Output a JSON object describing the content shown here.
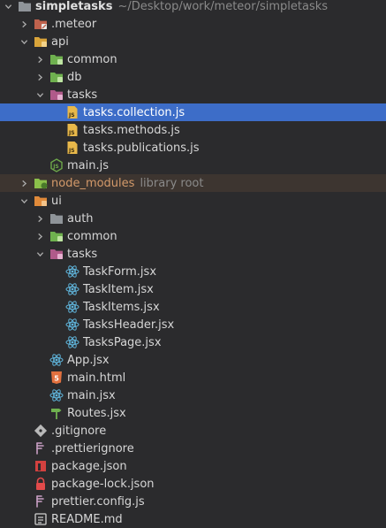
{
  "project": {
    "name": "simpletasks",
    "path": "~/Desktop/work/meteor/simpletasks"
  },
  "rows": [
    {
      "label": "simpletasks",
      "suffix": "~/Desktop/work/meteor/simpletasks",
      "icon": "folder-icon",
      "level": 0,
      "arrow": "down",
      "kind": "root"
    },
    {
      "label": ".meteor",
      "icon": "folder-icon",
      "level": 1,
      "arrow": "right"
    },
    {
      "label": "api",
      "icon": "folder-open-icon",
      "level": 1,
      "arrow": "down"
    },
    {
      "label": "common",
      "icon": "folder-icon",
      "level": 2,
      "arrow": "right"
    },
    {
      "label": "db",
      "icon": "folder-icon",
      "level": 2,
      "arrow": "right"
    },
    {
      "label": "tasks",
      "icon": "folder-icon",
      "level": 2,
      "arrow": "down"
    },
    {
      "label": "tasks.collection.js",
      "icon": "js-file-icon",
      "level": 3,
      "arrow": "none",
      "selected": true
    },
    {
      "label": "tasks.methods.js",
      "icon": "js-file-icon",
      "level": 3,
      "arrow": "none"
    },
    {
      "label": "tasks.publications.js",
      "icon": "js-file-icon",
      "level": 3,
      "arrow": "none"
    },
    {
      "label": "main.js",
      "icon": "nodejs-icon",
      "level": 2,
      "arrow": "none"
    },
    {
      "label": "node_modules",
      "suffix": "library root",
      "icon": "folder-icon",
      "level": 1,
      "arrow": "right",
      "kind": "excluded"
    },
    {
      "label": "ui",
      "icon": "folder-open-icon",
      "level": 1,
      "arrow": "down"
    },
    {
      "label": "auth",
      "icon": "folder-icon",
      "level": 2,
      "arrow": "right"
    },
    {
      "label": "common",
      "icon": "folder-icon",
      "level": 2,
      "arrow": "right"
    },
    {
      "label": "tasks",
      "icon": "folder-icon",
      "level": 2,
      "arrow": "down"
    },
    {
      "label": "TaskForm.jsx",
      "icon": "react-icon",
      "level": 3,
      "arrow": "none"
    },
    {
      "label": "TaskItem.jsx",
      "icon": "react-icon",
      "level": 3,
      "arrow": "none"
    },
    {
      "label": "TaskItems.jsx",
      "icon": "react-icon",
      "level": 3,
      "arrow": "none"
    },
    {
      "label": "TasksHeader.jsx",
      "icon": "react-icon",
      "level": 3,
      "arrow": "none"
    },
    {
      "label": "TasksPage.jsx",
      "icon": "react-icon",
      "level": 3,
      "arrow": "none"
    },
    {
      "label": "App.jsx",
      "icon": "react-icon",
      "level": 2,
      "arrow": "none"
    },
    {
      "label": "main.html",
      "icon": "html5-icon",
      "level": 2,
      "arrow": "none"
    },
    {
      "label": "main.jsx",
      "icon": "react-icon",
      "level": 2,
      "arrow": "none"
    },
    {
      "label": "Routes.jsx",
      "icon": "routes-icon",
      "level": 2,
      "arrow": "none"
    },
    {
      "label": ".gitignore",
      "icon": "git-icon",
      "level": 1,
      "arrow": "none"
    },
    {
      "label": ".prettierignore",
      "icon": "prettier-icon",
      "level": 1,
      "arrow": "none"
    },
    {
      "label": "package.json",
      "icon": "npm-icon",
      "level": 1,
      "arrow": "none"
    },
    {
      "label": "package-lock.json",
      "icon": "lock-icon",
      "level": 1,
      "arrow": "none"
    },
    {
      "label": "prettier.config.js",
      "icon": "prettier-icon",
      "level": 1,
      "arrow": "none"
    },
    {
      "label": "README.md",
      "icon": "readme-icon",
      "level": 1,
      "arrow": "none"
    }
  ],
  "folder_colors": {
    "default": "#8f9499",
    "meteor": "#c0624d",
    "api": "#d9a43a",
    "common": "#6fb14f",
    "db": "#6fb14f",
    "tasks": "#b05a8a",
    "node_modules": "#8bbf4a",
    "ui": "#e08a3a",
    "auth": "#8f9499"
  }
}
